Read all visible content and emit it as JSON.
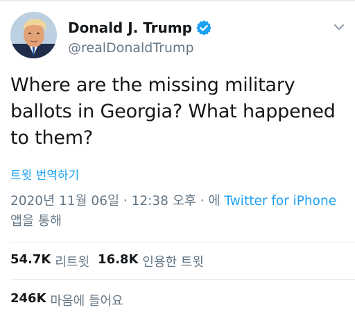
{
  "tweet": {
    "author": {
      "display_name": "Donald J. Trump",
      "handle": "@realDonaldTrump",
      "verified_icon": "verified-badge-icon",
      "avatar_icon": "avatar-photo"
    },
    "menu_icon": "chevron-down-icon",
    "text": "Where are the missing military ballots in Georgia? What happened to them?",
    "translate_label": "트윗 번역하기",
    "meta": {
      "date": "2020년 11월 06일",
      "separator1": " · ",
      "time": "12:38 오후",
      "separator2": " · 에 ",
      "app_link": "Twitter for iPhone",
      "suffix": " 앱을 통해"
    },
    "stats": {
      "retweets_count": "54.7K",
      "retweets_label": "리트윗",
      "quotes_count": "16.8K",
      "quotes_label": "인용한 트윗",
      "likes_count": "246K",
      "likes_label": "마음에 들어요"
    },
    "colors": {
      "accent": "#1da1f2",
      "text": "#14171a",
      "secondary": "#657786",
      "divider": "#e6ecf0"
    }
  }
}
